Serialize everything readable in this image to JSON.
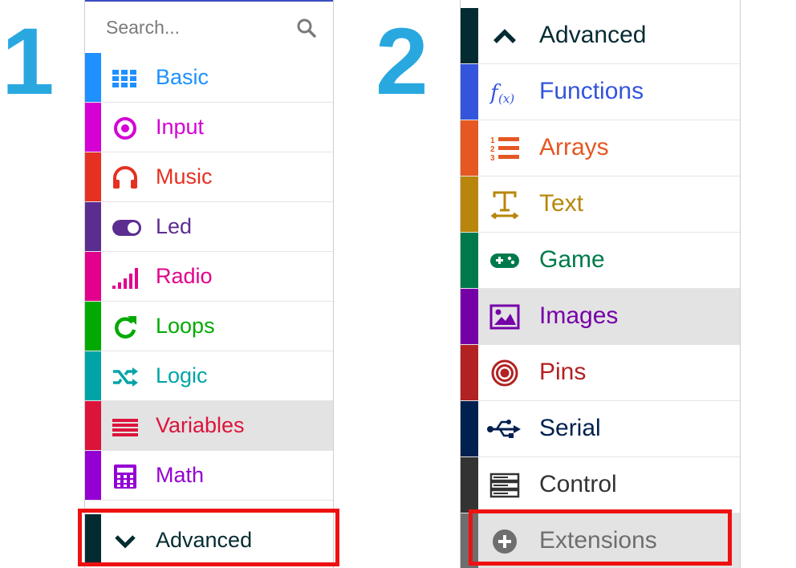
{
  "step_labels": [
    "1",
    "2"
  ],
  "panel1": {
    "search": {
      "placeholder": "Search...",
      "icon": "search-icon"
    },
    "categories": [
      {
        "label": "Basic",
        "color": "#1e90ff",
        "icon": "grid-icon"
      },
      {
        "label": "Input",
        "color": "#d400d4",
        "icon": "radio-button-icon"
      },
      {
        "label": "Music",
        "color": "#e63022",
        "icon": "headphones-icon"
      },
      {
        "label": "Led",
        "color": "#5c2d91",
        "icon": "toggle-icon"
      },
      {
        "label": "Radio",
        "color": "#e3008c",
        "icon": "signal-bars-icon"
      },
      {
        "label": "Loops",
        "color": "#00aa00",
        "icon": "refresh-icon"
      },
      {
        "label": "Logic",
        "color": "#00a4a6",
        "icon": "shuffle-icon"
      },
      {
        "label": "Variables",
        "color": "#dc143c",
        "icon": "list-lines-icon",
        "selected": true
      },
      {
        "label": "Math",
        "color": "#9400d3",
        "icon": "calculator-icon"
      }
    ],
    "advanced": {
      "label": "Advanced",
      "color": "#042b32",
      "icon": "chevron-down-icon"
    }
  },
  "panel2": {
    "categories": [
      {
        "label": "Advanced",
        "color": "#042b32",
        "icon": "chevron-up-icon"
      },
      {
        "label": "Functions",
        "color": "#3455db",
        "icon": "function-icon"
      },
      {
        "label": "Arrays",
        "color": "#e65722",
        "icon": "numbered-list-icon"
      },
      {
        "label": "Text",
        "color": "#b8860b",
        "icon": "text-icon"
      },
      {
        "label": "Game",
        "color": "#007a4b",
        "icon": "gamepad-icon"
      },
      {
        "label": "Images",
        "color": "#7600a8",
        "icon": "image-icon",
        "selected": true
      },
      {
        "label": "Pins",
        "color": "#b22222",
        "icon": "target-icon"
      },
      {
        "label": "Serial",
        "color": "#002050",
        "icon": "usb-icon"
      },
      {
        "label": "Control",
        "color": "#333333",
        "icon": "server-icon"
      },
      {
        "label": "Extensions",
        "color": "#6e6e6e",
        "icon": "plus-circle-icon"
      }
    ]
  }
}
